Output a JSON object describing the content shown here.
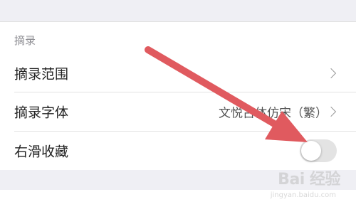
{
  "section": {
    "header": "摘录",
    "rows": [
      {
        "label": "摘录范围",
        "value": ""
      },
      {
        "label": "摘录字体",
        "value": "文悦古体仿宋（繁）"
      },
      {
        "label": "右滑收藏",
        "toggle": false
      }
    ]
  },
  "watermark": {
    "text": "Bai 经验",
    "sub": "jingyan.baidu.com"
  },
  "colors": {
    "arrow": "#e05a5f",
    "toggle_off": "#e3e3e3"
  },
  "icons": [
    "chevron-right-icon",
    "toggle-switch",
    "arrow-annotation-icon"
  ]
}
